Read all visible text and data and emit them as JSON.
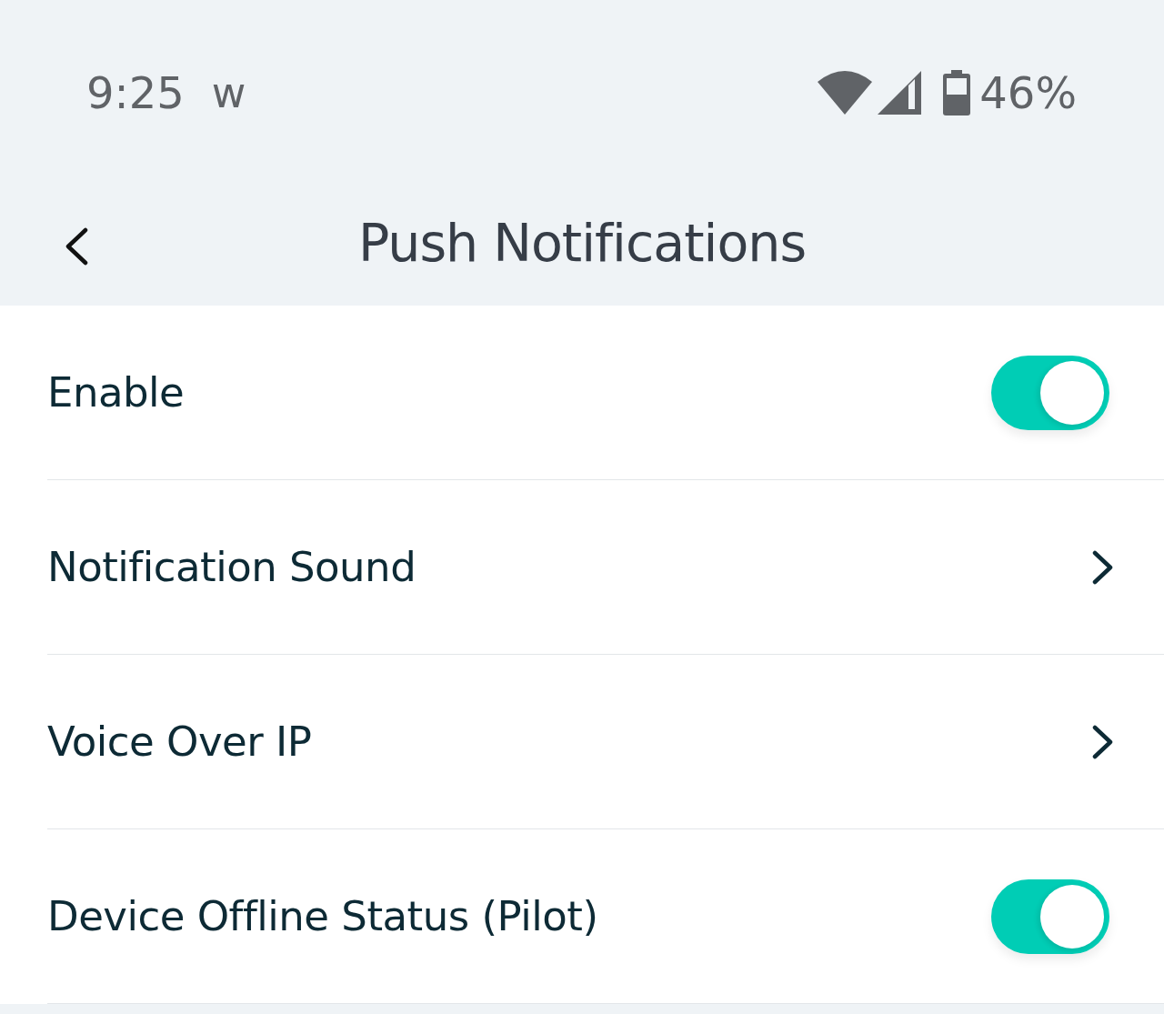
{
  "status_bar": {
    "time": "9:25",
    "app_indicator": "w",
    "battery": "46%"
  },
  "header": {
    "title": "Push Notifications"
  },
  "rows": [
    {
      "kind": "toggle",
      "label": "Enable",
      "on": true
    },
    {
      "kind": "link",
      "label": "Notification Sound"
    },
    {
      "kind": "link",
      "label": "Voice Over IP"
    },
    {
      "kind": "toggle",
      "label": "Device Offline Status (Pilot)",
      "on": true
    }
  ]
}
